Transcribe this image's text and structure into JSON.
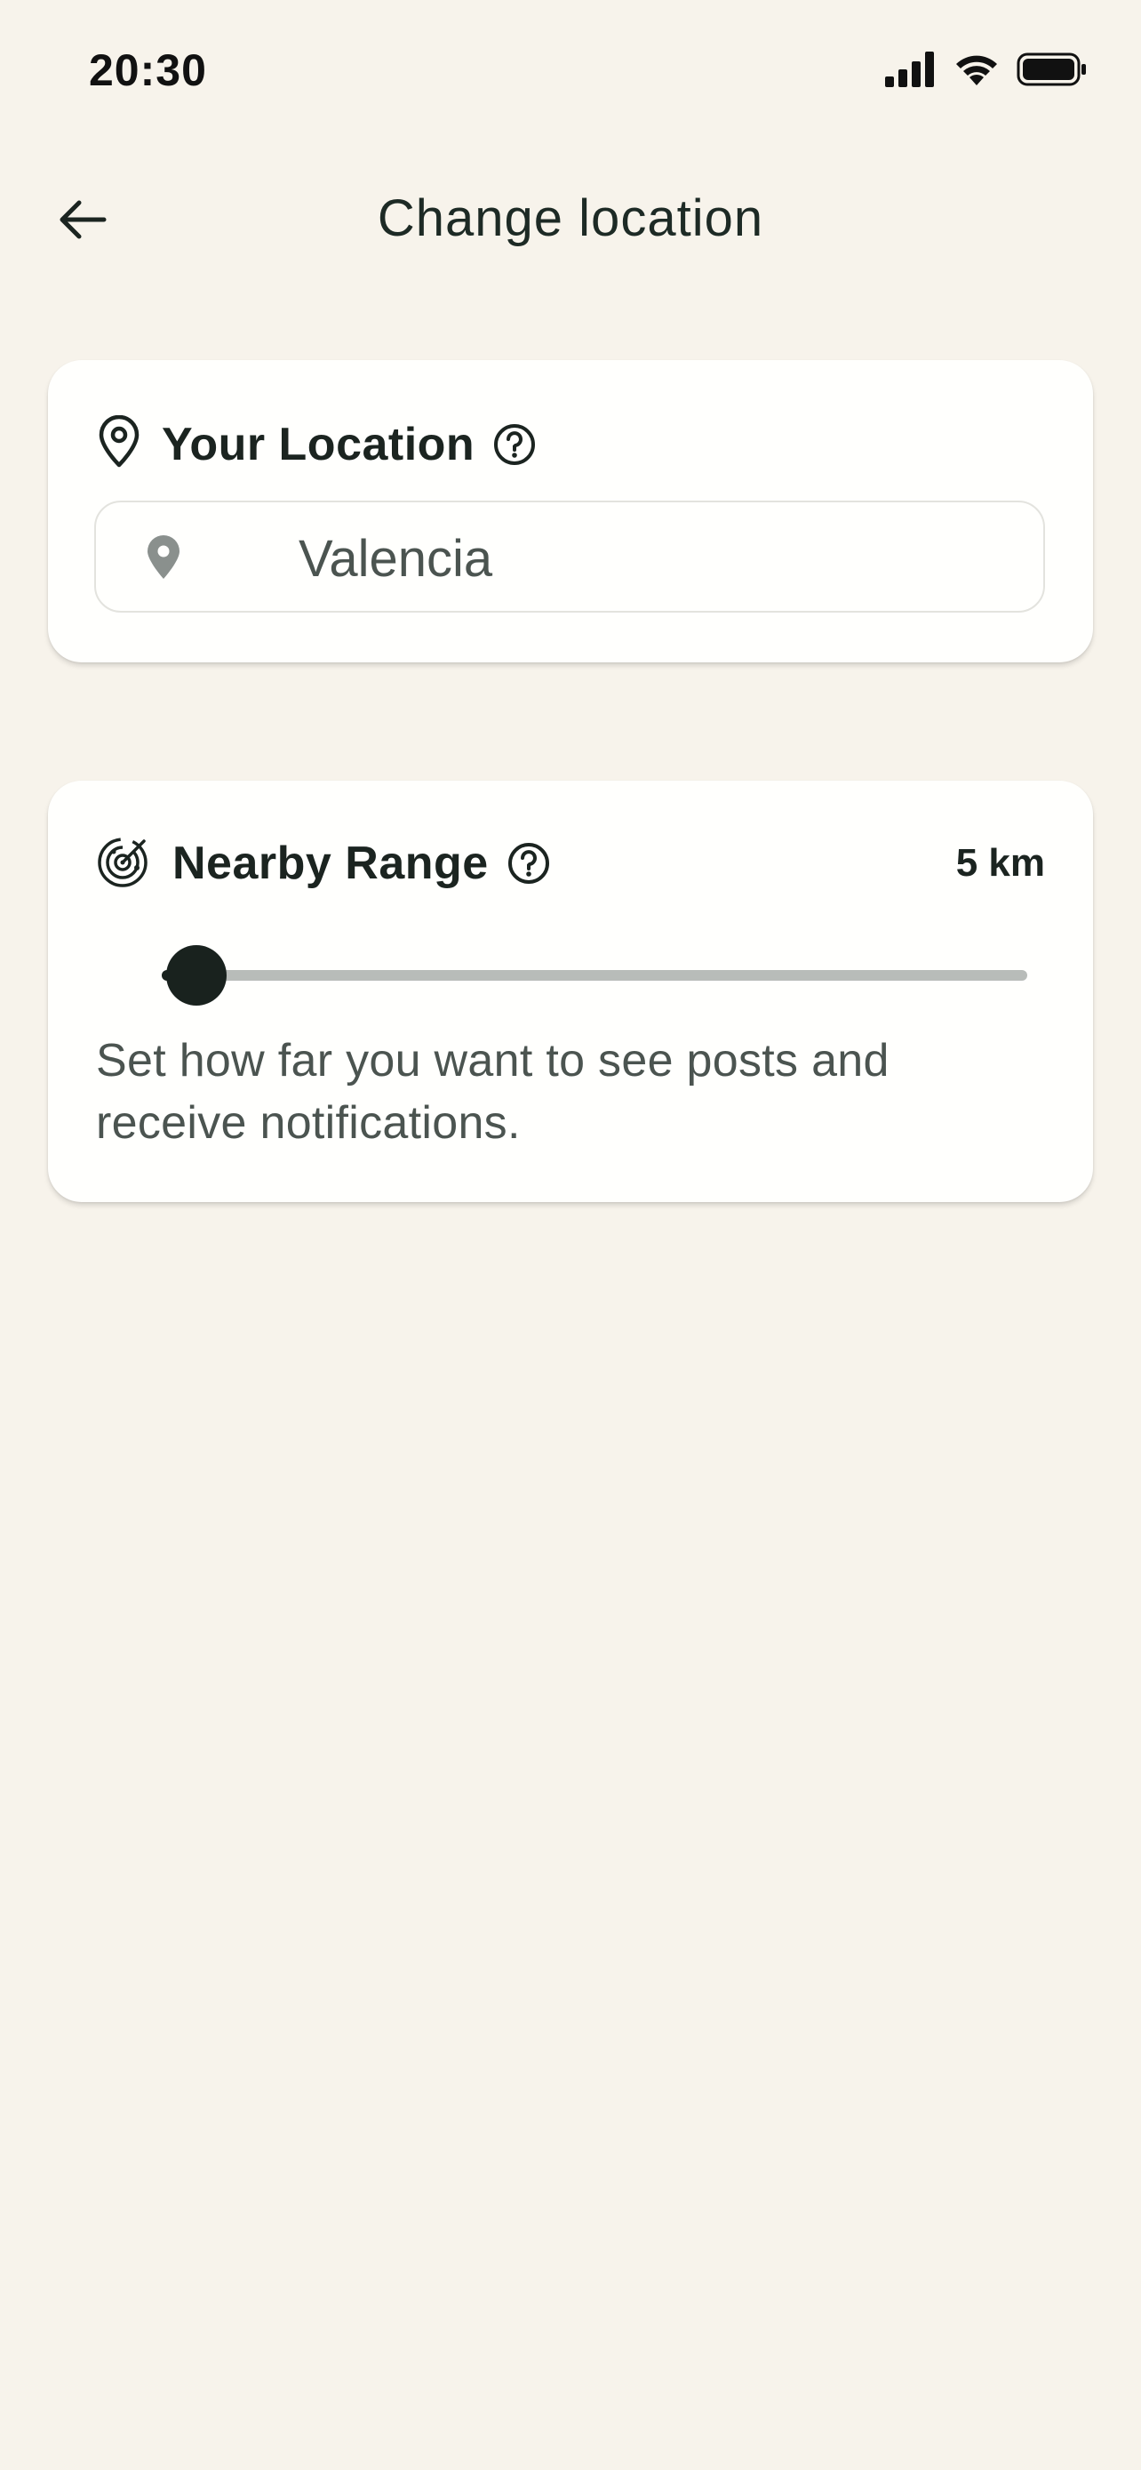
{
  "status_bar": {
    "time": "20:30"
  },
  "header": {
    "title": "Change location"
  },
  "location_card": {
    "title": "Your Location",
    "value": "Valencia"
  },
  "range_card": {
    "title": "Nearby Range",
    "value_label": "5 km",
    "slider_fraction": 0.04,
    "description": "Set how far you want to see posts and receive notifications."
  },
  "icons": {
    "back": "arrow-left-icon",
    "location": "map-pin-outline-icon",
    "pin_filled": "map-pin-filled-icon",
    "radar": "radar-icon",
    "help": "help-circle-icon"
  },
  "colors": {
    "background": "#f7f3eb",
    "card": "#fffffd",
    "accent": "#19221e",
    "track": "#b8bcb9"
  }
}
